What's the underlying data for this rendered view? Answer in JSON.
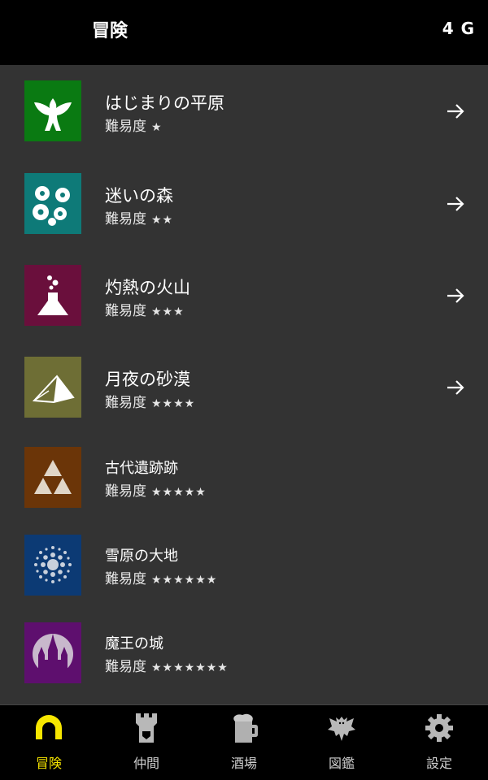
{
  "header": {
    "title": "冒険",
    "gold": "4 G"
  },
  "difficulty_label": "難易度",
  "stages": [
    {
      "name": "はじまりの平原",
      "stars": "★",
      "difficulty": 1,
      "color": "#0a7a12",
      "icon": "bird-icon",
      "unlocked": true
    },
    {
      "name": "迷いの森",
      "stars": "★★",
      "difficulty": 2,
      "color": "#0e7a78",
      "icon": "flowers-icon",
      "unlocked": true
    },
    {
      "name": "灼熱の火山",
      "stars": "★★★",
      "difficulty": 3,
      "color": "#6a0f3c",
      "icon": "flask-icon",
      "unlocked": true
    },
    {
      "name": "月夜の砂漠",
      "stars": "★★★★",
      "difficulty": 4,
      "color": "#6e6e35",
      "icon": "pyramid-icon",
      "unlocked": true
    },
    {
      "name": "古代遺跡跡",
      "stars": "★★★★★",
      "difficulty": 5,
      "color": "#6b3508",
      "icon": "triforce-icon",
      "unlocked": false
    },
    {
      "name": "雪原の大地",
      "stars": "★★★★★★",
      "difficulty": 6,
      "color": "#0c3a74",
      "icon": "snowflake-icon",
      "unlocked": false
    },
    {
      "name": "魔王の城",
      "stars": "★★★★★★★",
      "difficulty": 7,
      "color": "#5e0f6e",
      "icon": "castle-icon",
      "unlocked": false
    }
  ],
  "tabs": [
    {
      "label": "冒険",
      "icon": "arch-icon",
      "active": true
    },
    {
      "label": "仲間",
      "icon": "tower-icon",
      "active": false
    },
    {
      "label": "酒場",
      "icon": "beer-mug-icon",
      "active": false
    },
    {
      "label": "図鑑",
      "icon": "dragon-icon",
      "active": false
    },
    {
      "label": "設定",
      "icon": "gear-icon",
      "active": false
    }
  ],
  "colors": {
    "accent": "#f7e600",
    "list_bg": "#333333",
    "bar_bg": "#000000"
  }
}
